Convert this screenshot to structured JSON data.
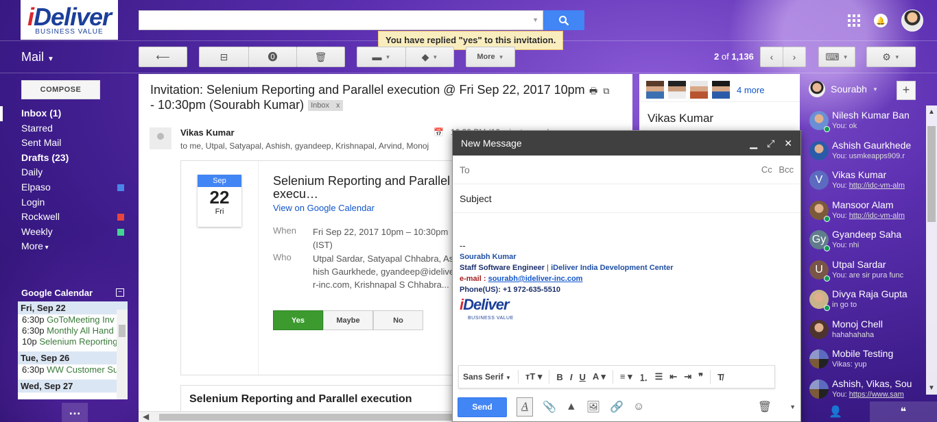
{
  "brand": {
    "logo_main": "Deliver",
    "logo_i": "i",
    "logo_sub": "BUSINESS VALUE"
  },
  "search": {
    "placeholder": "",
    "value": "",
    "button_icon": "search-icon"
  },
  "notice": "You have replied \"yes\" to this invitation.",
  "header": {
    "mail_label": "Mail"
  },
  "toolbar": {
    "more_label": "More",
    "pager_range": "2",
    "pager_of": "of",
    "pager_total": "1,136"
  },
  "compose_button": "COMPOSE",
  "nav": {
    "items": [
      {
        "label": "Inbox (1)",
        "bold": true
      },
      {
        "label": "Starred"
      },
      {
        "label": "Sent Mail"
      },
      {
        "label": "Drafts (23)",
        "bold": true
      },
      {
        "label": "Daily"
      },
      {
        "label": "Elpaso",
        "color": "#4a86e8"
      },
      {
        "label": "Login"
      },
      {
        "label": "Rockwell",
        "color": "#e8453c"
      },
      {
        "label": "Weekly",
        "color": "#43d692"
      },
      {
        "label": "More"
      }
    ]
  },
  "gcal": {
    "title": "Google Calendar",
    "days": [
      {
        "day": "Fri, Sep 22",
        "events": [
          {
            "time": "6:30p",
            "title": "GoToMeeting Inv"
          },
          {
            "time": "6:30p",
            "title": "Monthly All Hand"
          },
          {
            "time": "10p",
            "title": "Selenium Reporting"
          }
        ]
      },
      {
        "day": "Tue, Sep 26",
        "events": [
          {
            "time": "6:30p",
            "title": "WW Customer Su"
          }
        ]
      },
      {
        "day": "Wed, Sep 27",
        "events": []
      }
    ]
  },
  "email": {
    "subject": "Invitation: Selenium Reporting and Parallel execution @ Fri Sep 22, 2017 10pm - 10:30pm (Sourabh Kumar)",
    "label_chip": "Inbox",
    "sender": "Vikas Kumar",
    "recipients": "to me, Utpal, Satyapal, Ashish, gyandeep, Krishnapal, Arvind, Monoj",
    "time": "10:32 PM (12 minutes ago)",
    "invite": {
      "month": "Sep",
      "day": "22",
      "weekday": "Fri",
      "title": "Selenium Reporting and Parallel execu…",
      "view_link": "View on Google Calendar",
      "when_label": "When",
      "when_value": "Fri Sep 22, 2017 10pm – 10:30pm (IST)",
      "who_label": "Who",
      "who_value": "Utpal Sardar, Satyapal Chhabra, Ashish Gaurkhede, gyandeep@ideliver-inc.com, Krishnapal S Chhabra...",
      "rsvp": [
        "Yes",
        "Maybe",
        "No"
      ]
    },
    "section_title": "Selenium Reporting and Parallel execution"
  },
  "people": {
    "more_link": "4 more",
    "name": "Vikas Kumar"
  },
  "compose": {
    "title": "New Message",
    "to_label": "To",
    "cc_bcc": "Cc Bcc",
    "subject_label": "Subject",
    "signature": {
      "dash": "--",
      "name": "Sourabh Kumar",
      "role": "Staff Software Engineer",
      "company": "iDeliver India Development Center",
      "email_label": "e-mail :",
      "email": "sourabh@ideliver-inc.com",
      "phone_label": "Phone(US):",
      "phone": "+1 972-635-5510",
      "logo_main": "Deliver",
      "logo_i": "i",
      "logo_sub": "BUSINESS VALUE"
    },
    "font_name": "Sans Serif",
    "send_label": "Send"
  },
  "chat": {
    "me": "Sourabh",
    "contacts": [
      {
        "name": "Nilesh Kumar Ban",
        "msg": "You: ok",
        "avatar": "photo",
        "color": "#6a8fd4",
        "online": true
      },
      {
        "name": "Ashish Gaurkhede",
        "msg": "You: usmkeapps909.r",
        "avatar": "photo",
        "color": "#2b5aa8",
        "online": false
      },
      {
        "name": "Vikas Kumar",
        "msg": "You: http://idc-vm-alm",
        "avatar": "V",
        "color": "#5c6bc0",
        "online": false,
        "link": true
      },
      {
        "name": "Mansoor Alam",
        "msg": "You: http://idc-vm-alm",
        "avatar": "photo",
        "color": "#7b5a3a",
        "online": true,
        "link": true
      },
      {
        "name": "Gyandeep Saha",
        "msg": "You: nhi",
        "avatar": "Gy",
        "color": "#607d8b",
        "online": true
      },
      {
        "name": "Utpal Sardar",
        "msg": "You: are sir pura func",
        "avatar": "U",
        "color": "#795548",
        "online": true
      },
      {
        "name": "Divya Raja Gupta",
        "msg": "in go to",
        "avatar": "photo",
        "color": "#c8b48a",
        "online": true
      },
      {
        "name": "Monoj Chell",
        "msg": "hahahahaha",
        "avatar": "photo",
        "color": "#4e342e",
        "online": false
      },
      {
        "name": "Mobile Testing",
        "msg": "Vikas: yup",
        "avatar": "group",
        "color": "#5c6bc0",
        "online": false
      },
      {
        "name": "Ashish, Vikas, Sou",
        "msg": "You: https://www.sam",
        "avatar": "group",
        "color": "#5c6bc0",
        "online": false,
        "link": true
      }
    ]
  }
}
